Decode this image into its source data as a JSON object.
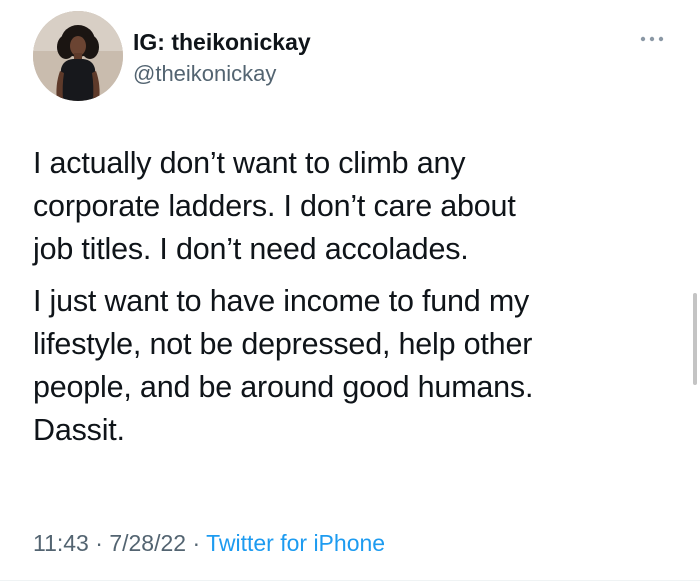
{
  "author": {
    "display_name": "IG: theikonickay",
    "handle": "@theikonickay",
    "avatar_icon": "profile-photo"
  },
  "more_icon": "more-horizontal-icon",
  "tweet": {
    "paragraphs": [
      "I actually don’t want to climb any\ncorporate ladders. I don’t care about\njob titles. I don’t need accolades.",
      "I just want to have income to fund my\nlifestyle, not be depressed, help other\npeople, and be around good humans.\nDassit."
    ]
  },
  "meta": {
    "time": "11:43",
    "separator1": " · ",
    "date": "7/28/22",
    "separator2": " · ",
    "source": "Twitter for iPhone"
  },
  "colors": {
    "text": "#0f1419",
    "secondary": "#536471",
    "link": "#1d9bf0"
  }
}
